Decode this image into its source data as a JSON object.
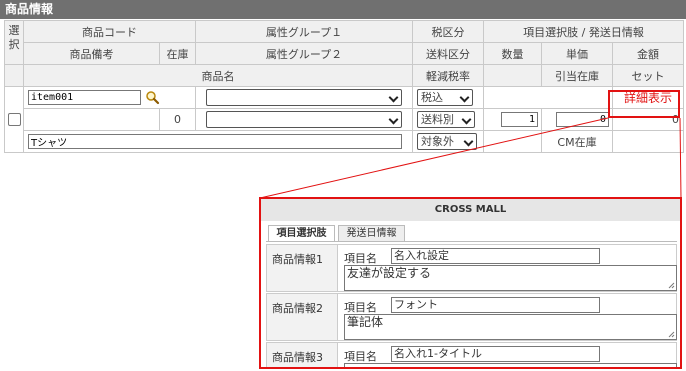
{
  "section_title": "商品情報",
  "headers": {
    "select": "選択",
    "product_code": "商品コード",
    "attr_group1": "属性グループ１",
    "tax_class": "税区分",
    "option_info": "項目選択肢 / 発送日情報",
    "product_note": "商品備考",
    "stock": "在庫",
    "attr_group2": "属性グループ２",
    "shipping_class": "送料区分",
    "quantity": "数量",
    "unit_price": "単価",
    "amount": "金額",
    "product_name": "商品名",
    "reduced_tax": "軽減税率",
    "allocated_stock": "引当在庫",
    "set": "セット"
  },
  "row": {
    "code_value": "item001",
    "tax_value": "税込",
    "detail_link": "詳細表示",
    "stock_value": "0",
    "shipping_value": "送料別",
    "quantity_value": "1",
    "unit_price_value": "0",
    "amount_value": "0",
    "name_value": "Tシャツ",
    "reduced_tax_value": "対象外",
    "allocated_stock_value": "CM在庫"
  },
  "popup": {
    "title": "CROSS MALL",
    "tabs": [
      "項目選択肢",
      "発送日情報"
    ],
    "field_label": "項目名",
    "items": [
      {
        "label": "商品情報1",
        "name": "名入れ設定",
        "text": "友達が設定する"
      },
      {
        "label": "商品情報2",
        "name": "フォント",
        "text": "筆記体"
      },
      {
        "label": "商品情報3",
        "name": "名入れ1-タイトル",
        "text": ""
      }
    ]
  },
  "colors": {
    "highlight": "#e21212",
    "header_bar": "#707070",
    "header_cell": "#f0f0f0"
  },
  "icons": [
    "search-icon",
    "chevron-down-icon",
    "checkbox-icon",
    "resize-grip-icon"
  ]
}
